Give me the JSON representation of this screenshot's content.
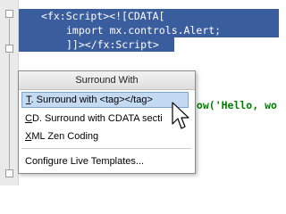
{
  "code": {
    "line1": "<fx:Script><![CDATA[",
    "line2": "import mx.controls.Alert;",
    "line3": "]]></fx:Script>",
    "line4_partial": "how('Hello, wo"
  },
  "popup": {
    "title": "Surround With",
    "items": [
      {
        "mnemonic": "T",
        "label": ". Surround with <tag></tag>"
      },
      {
        "mnemonic": "C",
        "label": "D. Surround with CDATA secti"
      },
      {
        "mnemonic": "X",
        "label": "ML Zen Coding"
      }
    ],
    "footer_item": "Configure Live Templates..."
  },
  "colors": {
    "selection": "#3a5d9d",
    "menu_highlight": "#c4d9f2",
    "string": "#008000"
  },
  "icons": [
    "fold-marker-icon",
    "mouse-pointer-icon"
  ]
}
